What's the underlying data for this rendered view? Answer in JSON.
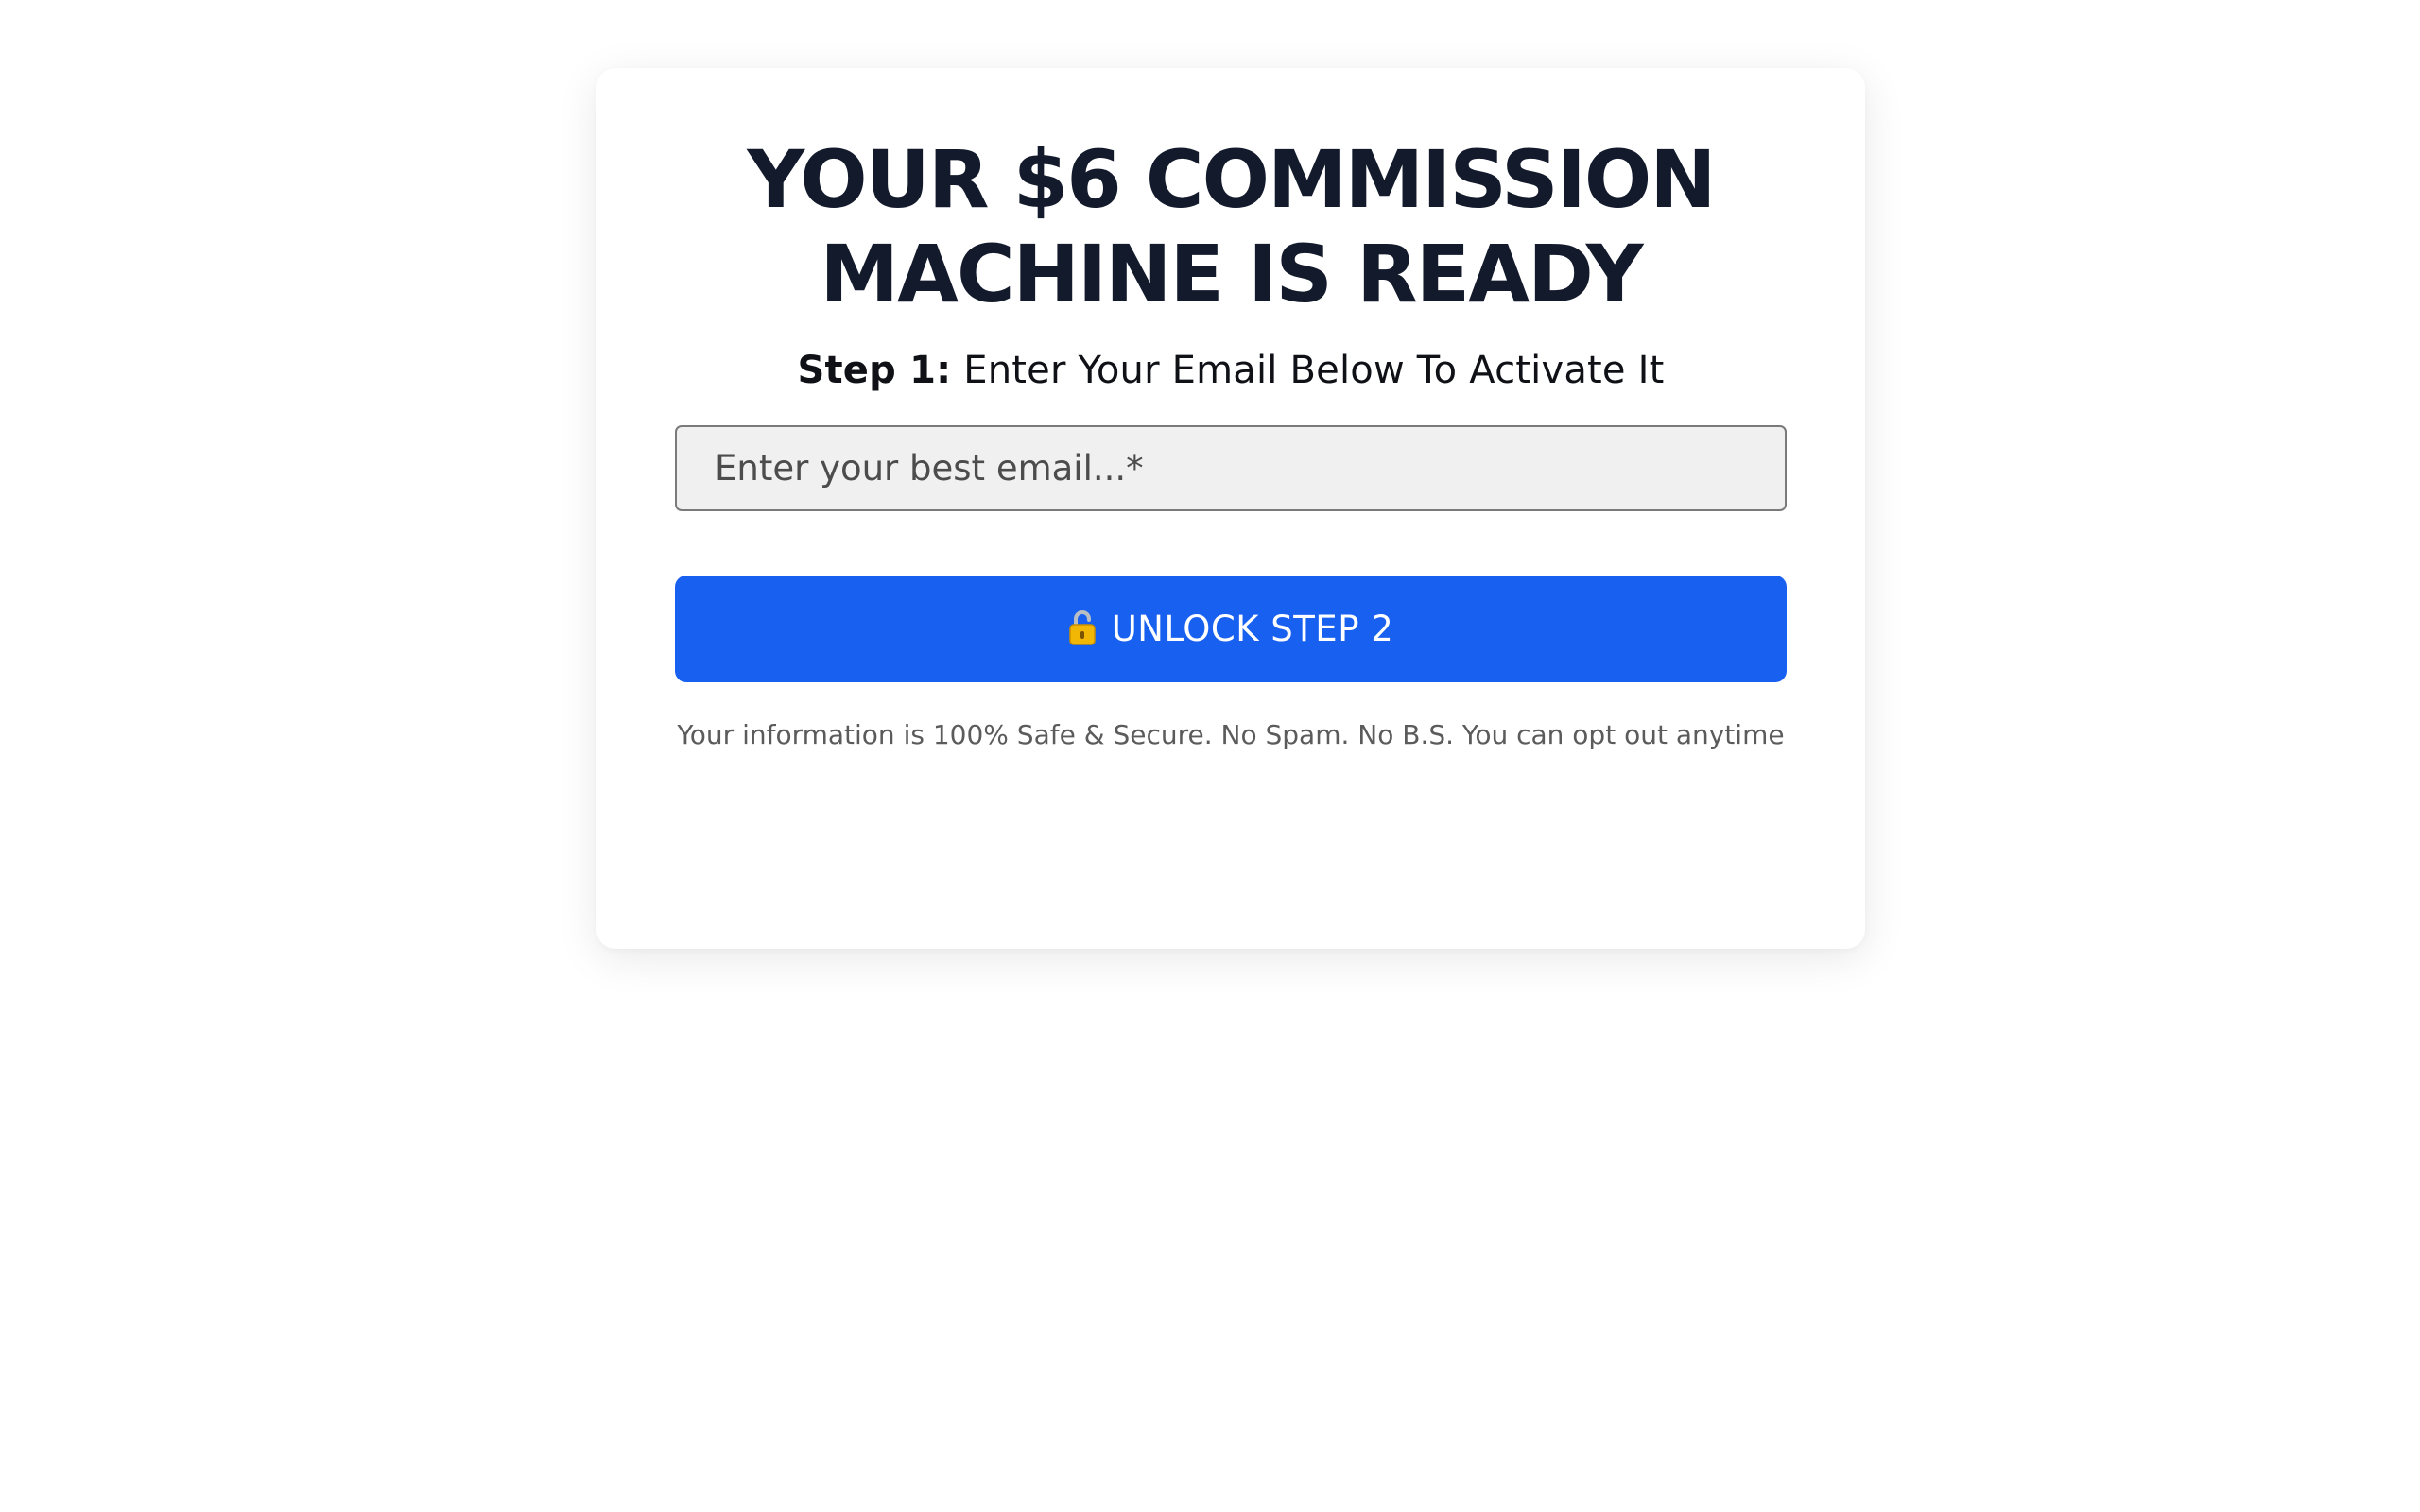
{
  "headline": {
    "line1": "YOUR $6 COMMISSION",
    "line2": "MACHINE IS READY"
  },
  "step": {
    "label": "Step 1:",
    "text": " Enter Your Email Below To Activate It"
  },
  "email": {
    "placeholder": "Enter your best email...*",
    "value": ""
  },
  "cta": {
    "icon": "open-lock-icon",
    "label": "UNLOCK STEP 2"
  },
  "disclaimer": "Your information is 100% Safe & Secure. No Spam. No B.S. You can opt out anytime",
  "colors": {
    "button": "#1860f0",
    "headline": "#131a2b",
    "input_bg": "#f0f0f0",
    "lock_gold": "#f2b705"
  }
}
